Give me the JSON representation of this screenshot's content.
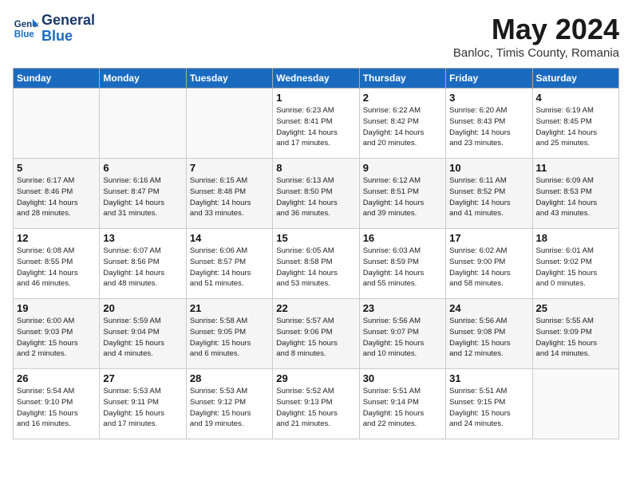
{
  "header": {
    "logo_line1": "General",
    "logo_line2": "Blue",
    "month": "May 2024",
    "location": "Banloc, Timis County, Romania"
  },
  "weekdays": [
    "Sunday",
    "Monday",
    "Tuesday",
    "Wednesday",
    "Thursday",
    "Friday",
    "Saturday"
  ],
  "weeks": [
    [
      {
        "day": "",
        "info": ""
      },
      {
        "day": "",
        "info": ""
      },
      {
        "day": "",
        "info": ""
      },
      {
        "day": "1",
        "info": "Sunrise: 6:23 AM\nSunset: 8:41 PM\nDaylight: 14 hours\nand 17 minutes."
      },
      {
        "day": "2",
        "info": "Sunrise: 6:22 AM\nSunset: 8:42 PM\nDaylight: 14 hours\nand 20 minutes."
      },
      {
        "day": "3",
        "info": "Sunrise: 6:20 AM\nSunset: 8:43 PM\nDaylight: 14 hours\nand 23 minutes."
      },
      {
        "day": "4",
        "info": "Sunrise: 6:19 AM\nSunset: 8:45 PM\nDaylight: 14 hours\nand 25 minutes."
      }
    ],
    [
      {
        "day": "5",
        "info": "Sunrise: 6:17 AM\nSunset: 8:46 PM\nDaylight: 14 hours\nand 28 minutes."
      },
      {
        "day": "6",
        "info": "Sunrise: 6:16 AM\nSunset: 8:47 PM\nDaylight: 14 hours\nand 31 minutes."
      },
      {
        "day": "7",
        "info": "Sunrise: 6:15 AM\nSunset: 8:48 PM\nDaylight: 14 hours\nand 33 minutes."
      },
      {
        "day": "8",
        "info": "Sunrise: 6:13 AM\nSunset: 8:50 PM\nDaylight: 14 hours\nand 36 minutes."
      },
      {
        "day": "9",
        "info": "Sunrise: 6:12 AM\nSunset: 8:51 PM\nDaylight: 14 hours\nand 39 minutes."
      },
      {
        "day": "10",
        "info": "Sunrise: 6:11 AM\nSunset: 8:52 PM\nDaylight: 14 hours\nand 41 minutes."
      },
      {
        "day": "11",
        "info": "Sunrise: 6:09 AM\nSunset: 8:53 PM\nDaylight: 14 hours\nand 43 minutes."
      }
    ],
    [
      {
        "day": "12",
        "info": "Sunrise: 6:08 AM\nSunset: 8:55 PM\nDaylight: 14 hours\nand 46 minutes."
      },
      {
        "day": "13",
        "info": "Sunrise: 6:07 AM\nSunset: 8:56 PM\nDaylight: 14 hours\nand 48 minutes."
      },
      {
        "day": "14",
        "info": "Sunrise: 6:06 AM\nSunset: 8:57 PM\nDaylight: 14 hours\nand 51 minutes."
      },
      {
        "day": "15",
        "info": "Sunrise: 6:05 AM\nSunset: 8:58 PM\nDaylight: 14 hours\nand 53 minutes."
      },
      {
        "day": "16",
        "info": "Sunrise: 6:03 AM\nSunset: 8:59 PM\nDaylight: 14 hours\nand 55 minutes."
      },
      {
        "day": "17",
        "info": "Sunrise: 6:02 AM\nSunset: 9:00 PM\nDaylight: 14 hours\nand 58 minutes."
      },
      {
        "day": "18",
        "info": "Sunrise: 6:01 AM\nSunset: 9:02 PM\nDaylight: 15 hours\nand 0 minutes."
      }
    ],
    [
      {
        "day": "19",
        "info": "Sunrise: 6:00 AM\nSunset: 9:03 PM\nDaylight: 15 hours\nand 2 minutes."
      },
      {
        "day": "20",
        "info": "Sunrise: 5:59 AM\nSunset: 9:04 PM\nDaylight: 15 hours\nand 4 minutes."
      },
      {
        "day": "21",
        "info": "Sunrise: 5:58 AM\nSunset: 9:05 PM\nDaylight: 15 hours\nand 6 minutes."
      },
      {
        "day": "22",
        "info": "Sunrise: 5:57 AM\nSunset: 9:06 PM\nDaylight: 15 hours\nand 8 minutes."
      },
      {
        "day": "23",
        "info": "Sunrise: 5:56 AM\nSunset: 9:07 PM\nDaylight: 15 hours\nand 10 minutes."
      },
      {
        "day": "24",
        "info": "Sunrise: 5:56 AM\nSunset: 9:08 PM\nDaylight: 15 hours\nand 12 minutes."
      },
      {
        "day": "25",
        "info": "Sunrise: 5:55 AM\nSunset: 9:09 PM\nDaylight: 15 hours\nand 14 minutes."
      }
    ],
    [
      {
        "day": "26",
        "info": "Sunrise: 5:54 AM\nSunset: 9:10 PM\nDaylight: 15 hours\nand 16 minutes."
      },
      {
        "day": "27",
        "info": "Sunrise: 5:53 AM\nSunset: 9:11 PM\nDaylight: 15 hours\nand 17 minutes."
      },
      {
        "day": "28",
        "info": "Sunrise: 5:53 AM\nSunset: 9:12 PM\nDaylight: 15 hours\nand 19 minutes."
      },
      {
        "day": "29",
        "info": "Sunrise: 5:52 AM\nSunset: 9:13 PM\nDaylight: 15 hours\nand 21 minutes."
      },
      {
        "day": "30",
        "info": "Sunrise: 5:51 AM\nSunset: 9:14 PM\nDaylight: 15 hours\nand 22 minutes."
      },
      {
        "day": "31",
        "info": "Sunrise: 5:51 AM\nSunset: 9:15 PM\nDaylight: 15 hours\nand 24 minutes."
      },
      {
        "day": "",
        "info": ""
      }
    ]
  ]
}
